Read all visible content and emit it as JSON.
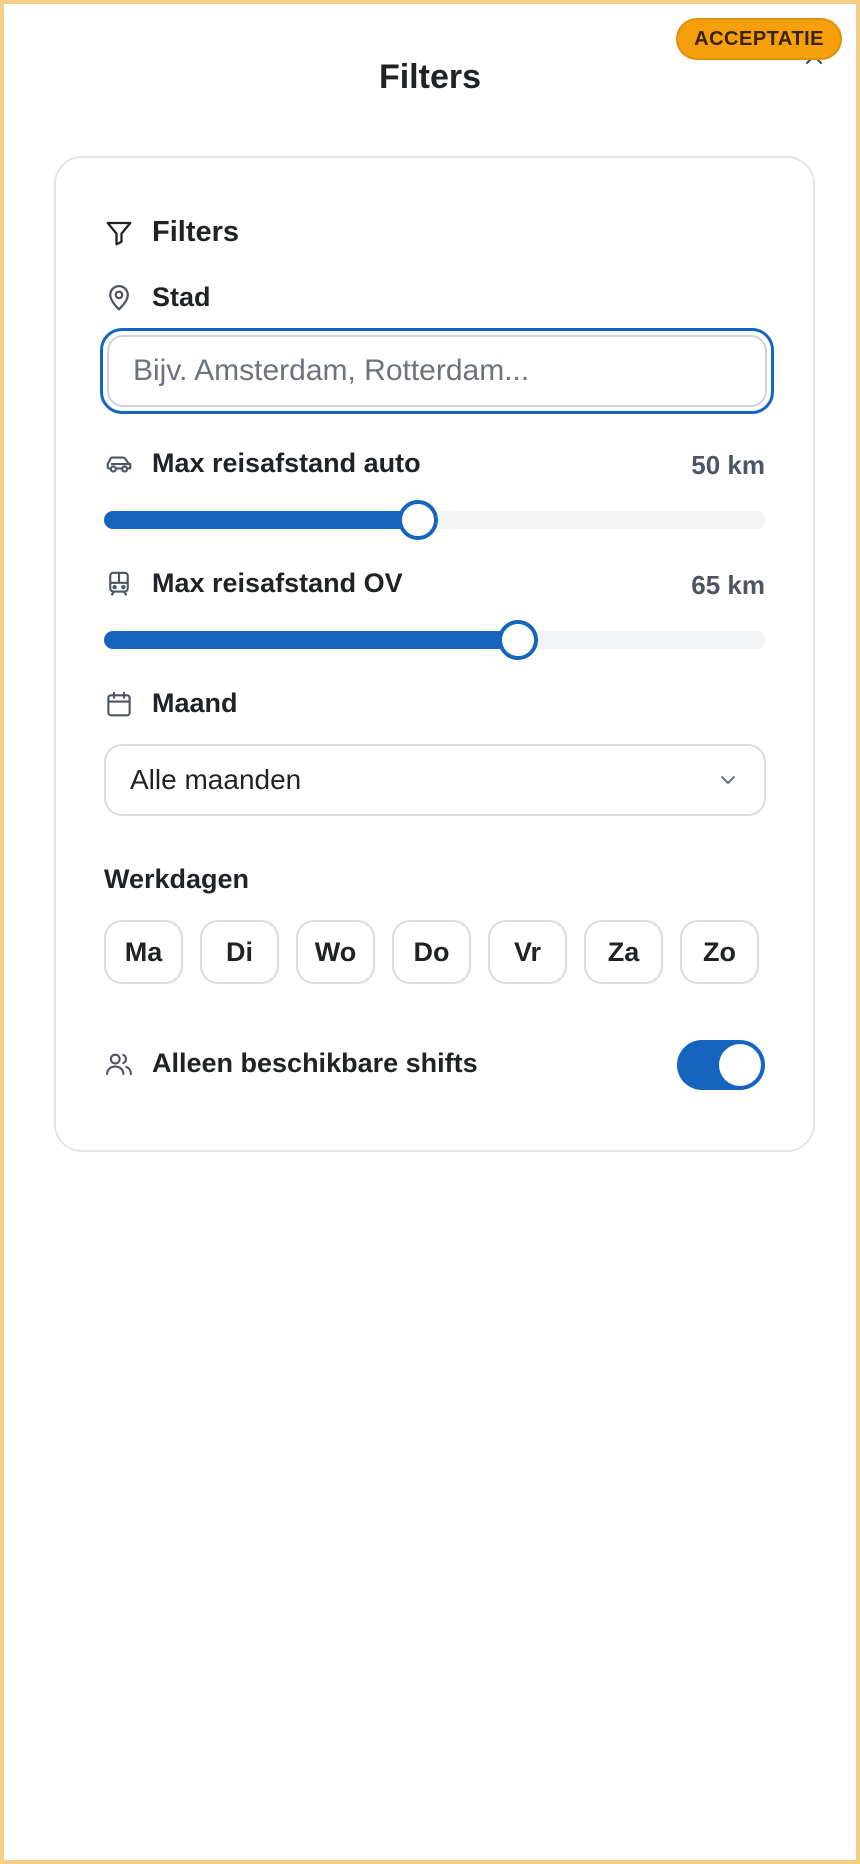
{
  "environment_badge": "ACCEPTATIE",
  "page_title": "Filters",
  "card": {
    "title": "Filters",
    "city": {
      "label": "Stad",
      "value": "",
      "placeholder": "Bijv. Amsterdam, Rotterdam..."
    },
    "car_distance": {
      "label": "Max reisafstand auto",
      "value_text": "50 km",
      "fraction": 0.475
    },
    "ov_distance": {
      "label": "Max reisafstand OV",
      "value_text": "65 km",
      "fraction": 0.625
    },
    "month": {
      "label": "Maand",
      "selected": "Alle maanden"
    },
    "workdays": {
      "label": "Werkdagen",
      "days": [
        "Ma",
        "Di",
        "Wo",
        "Do",
        "Vr",
        "Za",
        "Zo"
      ]
    },
    "available_only": {
      "label": "Alleen beschikbare shifts",
      "enabled": true
    }
  },
  "colors": {
    "accent": "#1565c0",
    "badge": "#f59f0a",
    "frame": "#f3cf86"
  },
  "icons": [
    "close-icon",
    "filter-icon",
    "map-pin-icon",
    "car-icon",
    "train-icon",
    "calendar-icon",
    "chevron-down-icon",
    "users-icon"
  ]
}
